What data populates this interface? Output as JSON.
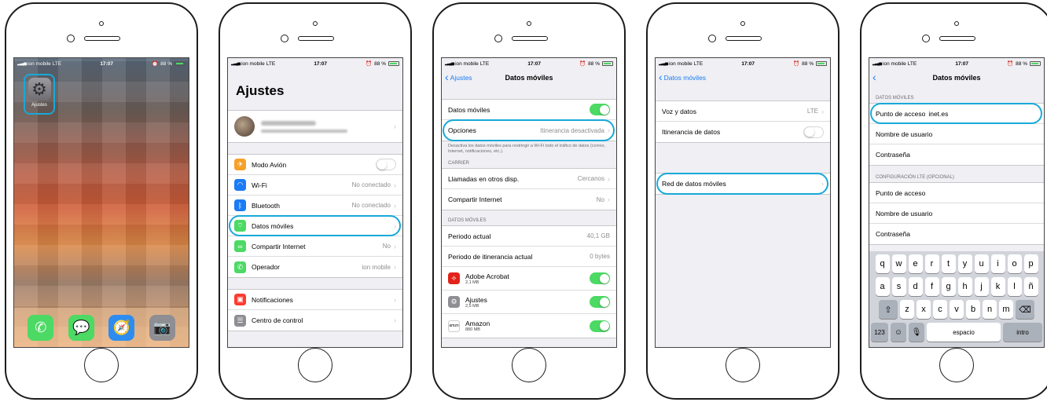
{
  "status": {
    "carrier": "ion mobile",
    "network": "LTE",
    "time": "17:07",
    "battery": "88 %"
  },
  "screen1": {
    "settings_app_label": "Ajustes"
  },
  "screen2": {
    "title": "Ajustes",
    "rows": [
      {
        "label": "Modo Avión",
        "value": ""
      },
      {
        "label": "Wi-Fi",
        "value": "No conectado"
      },
      {
        "label": "Bluetooth",
        "value": "No conectado"
      },
      {
        "label": "Datos móviles",
        "value": ""
      },
      {
        "label": "Compartir Internet",
        "value": "No"
      },
      {
        "label": "Operador",
        "value": "ion mobile"
      }
    ],
    "rows2": [
      {
        "label": "Notificaciones"
      },
      {
        "label": "Centro de control"
      }
    ]
  },
  "screen3": {
    "back": "Ajustes",
    "title": "Datos móviles",
    "datos_moviles": "Datos móviles",
    "opciones": "Opciones",
    "opciones_value": "Itinerancia desactivada",
    "footnote": "Desactiva los datos móviles para restringir a Wi-Fi todo el tráfico de datos (correo, Internet, notificaciones, etc.).",
    "carrier_header": "CARRIER",
    "llamadas": "Llamadas en otros disp.",
    "llamadas_value": "Cercanos",
    "compartir": "Compartir Internet",
    "compartir_value": "No",
    "datos_header": "DATOS MÓVILES",
    "periodo": "Periodo actual",
    "periodo_value": "40,1 GB",
    "periodo_itin": "Periodo de itinerancia actual",
    "periodo_itin_value": "0 bytes",
    "apps": [
      {
        "name": "Adobe Acrobat",
        "size": "2,1 MB"
      },
      {
        "name": "Ajustes",
        "size": "2,5 MB"
      },
      {
        "name": "Amazon",
        "size": "880 MB"
      }
    ]
  },
  "screen4": {
    "back": "Datos móviles",
    "voz": "Voz y datos",
    "voz_value": "LTE",
    "itinerancia": "Itinerancia de datos",
    "red": "Red de datos móviles"
  },
  "screen5": {
    "title": "Datos móviles",
    "header1": "DATOS MÓVILES",
    "apn_label": "Punto de acceso",
    "apn_value": "inet.es",
    "user": "Nombre de usuario",
    "pass": "Contraseña",
    "header2": "CONFIGURACIÓN LTE (OPCIONAL)",
    "apn2": "Punto de acceso",
    "user2": "Nombre de usuario",
    "pass2": "Contraseña",
    "keys_row1": [
      "q",
      "w",
      "e",
      "r",
      "t",
      "y",
      "u",
      "i",
      "o",
      "p"
    ],
    "keys_row2": [
      "a",
      "s",
      "d",
      "f",
      "g",
      "h",
      "j",
      "k",
      "l",
      "ñ"
    ],
    "keys_row3": [
      "z",
      "x",
      "c",
      "v",
      "b",
      "n",
      "m"
    ],
    "key_123": "123",
    "key_space": "espacio",
    "key_intro": "intro"
  },
  "colors": {
    "highlight": "#18a9d9",
    "ios_blue": "#1b7cf5",
    "toggle_green": "#4cd964"
  }
}
